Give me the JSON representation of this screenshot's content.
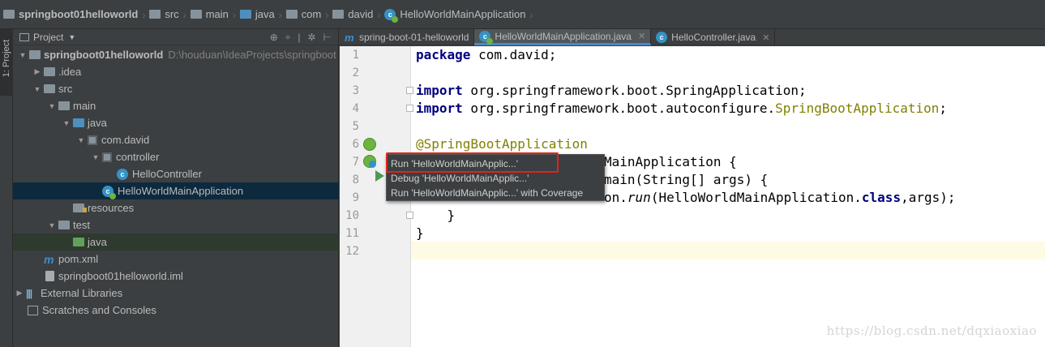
{
  "breadcrumb": [
    {
      "label": "springboot01helloworld",
      "icon": "module-folder-icon",
      "bold": true
    },
    {
      "label": "src",
      "icon": "folder-icon"
    },
    {
      "label": "main",
      "icon": "folder-icon"
    },
    {
      "label": "java",
      "icon": "source-folder-icon"
    },
    {
      "label": "com",
      "icon": "package-icon"
    },
    {
      "label": "david",
      "icon": "package-icon"
    },
    {
      "label": "HelloWorldMainApplication",
      "icon": "spring-class-icon"
    }
  ],
  "toolstrip": {
    "project_tab": "1: Project"
  },
  "project_panel": {
    "title": "Project",
    "tree": [
      {
        "label": "springboot01helloworld",
        "path": "D:\\houduan\\IdeaProjects\\springboot",
        "bold": true
      },
      {
        "label": ".idea"
      },
      {
        "label": "src"
      },
      {
        "label": "main"
      },
      {
        "label": "java"
      },
      {
        "label": "com.david"
      },
      {
        "label": "controller"
      },
      {
        "label": "HelloController"
      },
      {
        "label": "HelloWorldMainApplication"
      },
      {
        "label": "resources"
      },
      {
        "label": "test"
      },
      {
        "label": "java"
      },
      {
        "label": "pom.xml"
      },
      {
        "label": "springboot01helloworld.iml"
      },
      {
        "label": "External Libraries"
      },
      {
        "label": "Scratches and Consoles"
      }
    ]
  },
  "tabs": [
    {
      "label": "spring-boot-01-helloworld",
      "icon": "maven-icon"
    },
    {
      "label": "HelloWorldMainApplication.java",
      "icon": "spring-class-icon",
      "active": true
    },
    {
      "label": "HelloController.java",
      "icon": "class-icon"
    }
  ],
  "editor": {
    "line_numbers": [
      "1",
      "2",
      "3",
      "4",
      "5",
      "6",
      "7",
      "8",
      "9",
      "10",
      "11",
      "12"
    ],
    "code": {
      "l1_kw": "package",
      "l1_rest": " com.david;",
      "l3_kw": "import",
      "l3_rest": " org.springframework.boot.SpringApplication;",
      "l4_kw": "import",
      "l4_rest": " org.springframework.boot.autoconfigure.",
      "l4_anno": "SpringBootApplication",
      "l4_end": ";",
      "l6_anno": "@SpringBootApplication",
      "l7_rest": "MainApplication {",
      "l8_rest": "main(String[] args) {",
      "l9_rest": "on.",
      "l9_static": "run",
      "l9_mid": "(HelloWorldMainApplication.",
      "l9_kw": "class",
      "l9_end": ",args);",
      "l10": "    }",
      "l11": "}"
    }
  },
  "popup_menu": {
    "items": [
      "Run 'HelloWorldMainApplic...'",
      "Debug 'HelloWorldMainApplic...'",
      "Run 'HelloWorldMainApplic...' with Coverage"
    ]
  },
  "watermark": "https://blog.csdn.net/dqxiaoxiao",
  "colors": {
    "panel_bg": "#3c3f41",
    "selection": "#0d293e",
    "keyword": "#000080",
    "annotation": "#808000",
    "highlight_box": "#e2231a"
  }
}
